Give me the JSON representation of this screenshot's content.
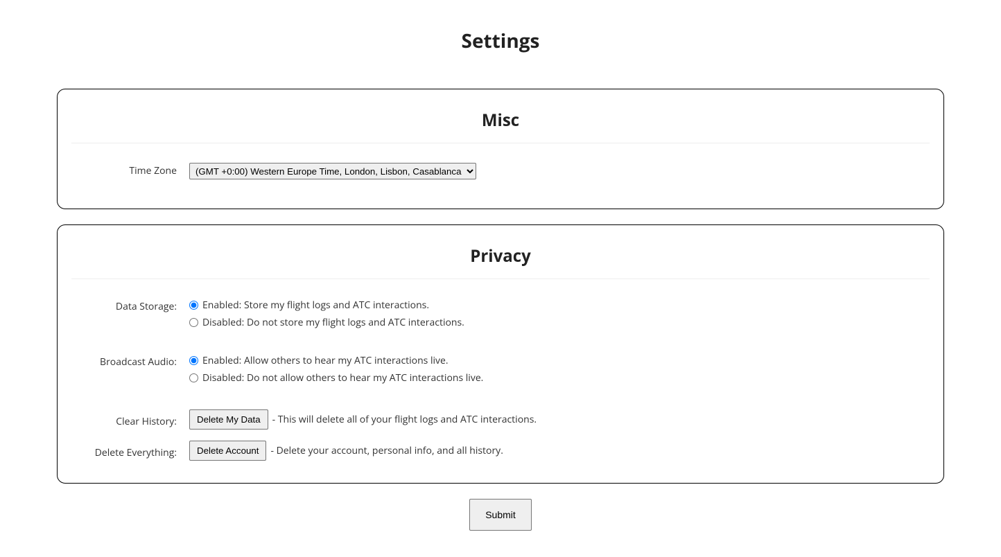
{
  "page": {
    "title": "Settings"
  },
  "misc": {
    "heading": "Misc",
    "timezone": {
      "label": "Time Zone",
      "selected": "(GMT +0:00) Western Europe Time, London, Lisbon, Casablanca"
    }
  },
  "privacy": {
    "heading": "Privacy",
    "data_storage": {
      "label": "Data Storage:",
      "enabled_label": "Enabled: Store my flight logs and ATC interactions.",
      "disabled_label": "Disabled: Do not store my flight logs and ATC interactions.",
      "value": "enabled"
    },
    "broadcast_audio": {
      "label": "Broadcast Audio:",
      "enabled_label": "Enabled: Allow others to hear my ATC interactions live.",
      "disabled_label": "Disabled: Do not allow others to hear my ATC interactions live.",
      "value": "enabled"
    },
    "clear_history": {
      "label": "Clear History:",
      "button": "Delete My Data",
      "desc": "- This will delete all of your flight logs and ATC interactions."
    },
    "delete_everything": {
      "label": "Delete Everything:",
      "button": "Delete Account",
      "desc": "- Delete your account, personal info, and all history."
    }
  },
  "submit": {
    "label": "Submit"
  }
}
